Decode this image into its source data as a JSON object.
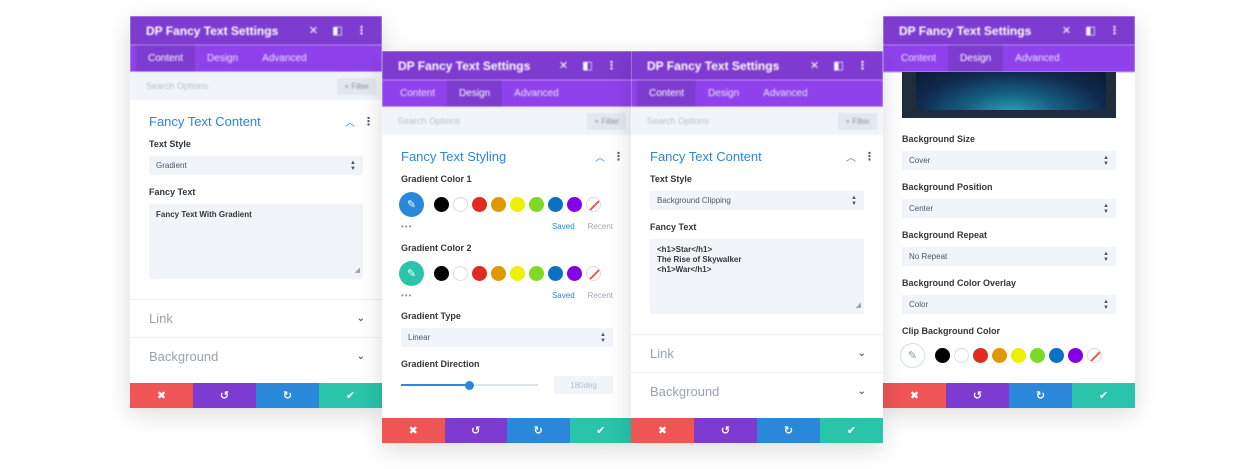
{
  "colors": {
    "title_bar": "#7e3bd0",
    "tab_bar": "#8f42ec",
    "accent": "#2b87da",
    "btn_red": "#ef5555",
    "btn_purple": "#7e3bd0",
    "btn_blue": "#2b87da",
    "btn_green": "#29c4a9"
  },
  "swatches": [
    "#000000",
    "#ffffff",
    "#e02b20",
    "#e09900",
    "#edf000",
    "#7cda24",
    "#0c71c3",
    "#8300e9"
  ],
  "icons": {
    "close": "close-icon",
    "dock": "sidebar-toggle-icon",
    "expand": "expand-icon",
    "dropper": "eyedropper-icon",
    "undo": "undo-icon",
    "redo": "redo-icon",
    "save": "check-icon",
    "discard": "close-icon"
  },
  "panel1": {
    "title": "DP Fancy Text Settings",
    "tabs": [
      "Content",
      "Design",
      "Advanced"
    ],
    "search_placeholder": "Search Options",
    "filter_label": "+ Filter",
    "section_title": "Fancy Text Content",
    "text_style_label": "Text Style",
    "text_style_value": "Gradient",
    "fancy_text_label": "Fancy Text",
    "fancy_text_value": "Fancy Text With Gradient",
    "toggle_link": "Link",
    "toggle_background": "Background"
  },
  "panel2": {
    "title": "DP Fancy Text Settings",
    "tabs": [
      "Content",
      "Design",
      "Advanced"
    ],
    "search_placeholder": "Search Options",
    "filter_label": "+ Filter",
    "section_title": "Fancy Text Styling",
    "gradient_color_1_label": "Gradient Color 1",
    "gradient_color_1": "#2b87da",
    "gradient_color_2_label": "Gradient Color 2",
    "gradient_color_2": "#29c4a9",
    "more_dots": "•••",
    "saved_label": "Saved",
    "recent_label": "Recent",
    "gradient_type_label": "Gradient Type",
    "gradient_type_value": "Linear",
    "gradient_direction_label": "Gradient Direction",
    "gradient_direction_value": "180deg",
    "gradient_direction_fraction": 0.5
  },
  "panel3": {
    "title": "DP Fancy Text Settings",
    "tabs": [
      "Content",
      "Design",
      "Advanced"
    ],
    "search_placeholder": "Search Options",
    "filter_label": "+ Filter",
    "section_title": "Fancy Text Content",
    "text_style_label": "Text Style",
    "text_style_value": "Background Clipping",
    "fancy_text_label": "Fancy Text",
    "fancy_text_lines": [
      "<h1>Star</h1>",
      "The Rise of Skywalker",
      "<h1>War</h1>"
    ],
    "toggle_link": "Link",
    "toggle_background": "Background"
  },
  "panel4": {
    "title": "DP Fancy Text Settings",
    "tabs": [
      "Content",
      "Design",
      "Advanced"
    ],
    "bg_size_label": "Background Size",
    "bg_size_value": "Cover",
    "bg_position_label": "Background Position",
    "bg_position_value": "Center",
    "bg_repeat_label": "Background Repeat",
    "bg_repeat_value": "No Repeat",
    "bg_overlay_label": "Background Color Overlay",
    "bg_overlay_value": "Color",
    "clip_bg_color_label": "Clip Background Color"
  }
}
